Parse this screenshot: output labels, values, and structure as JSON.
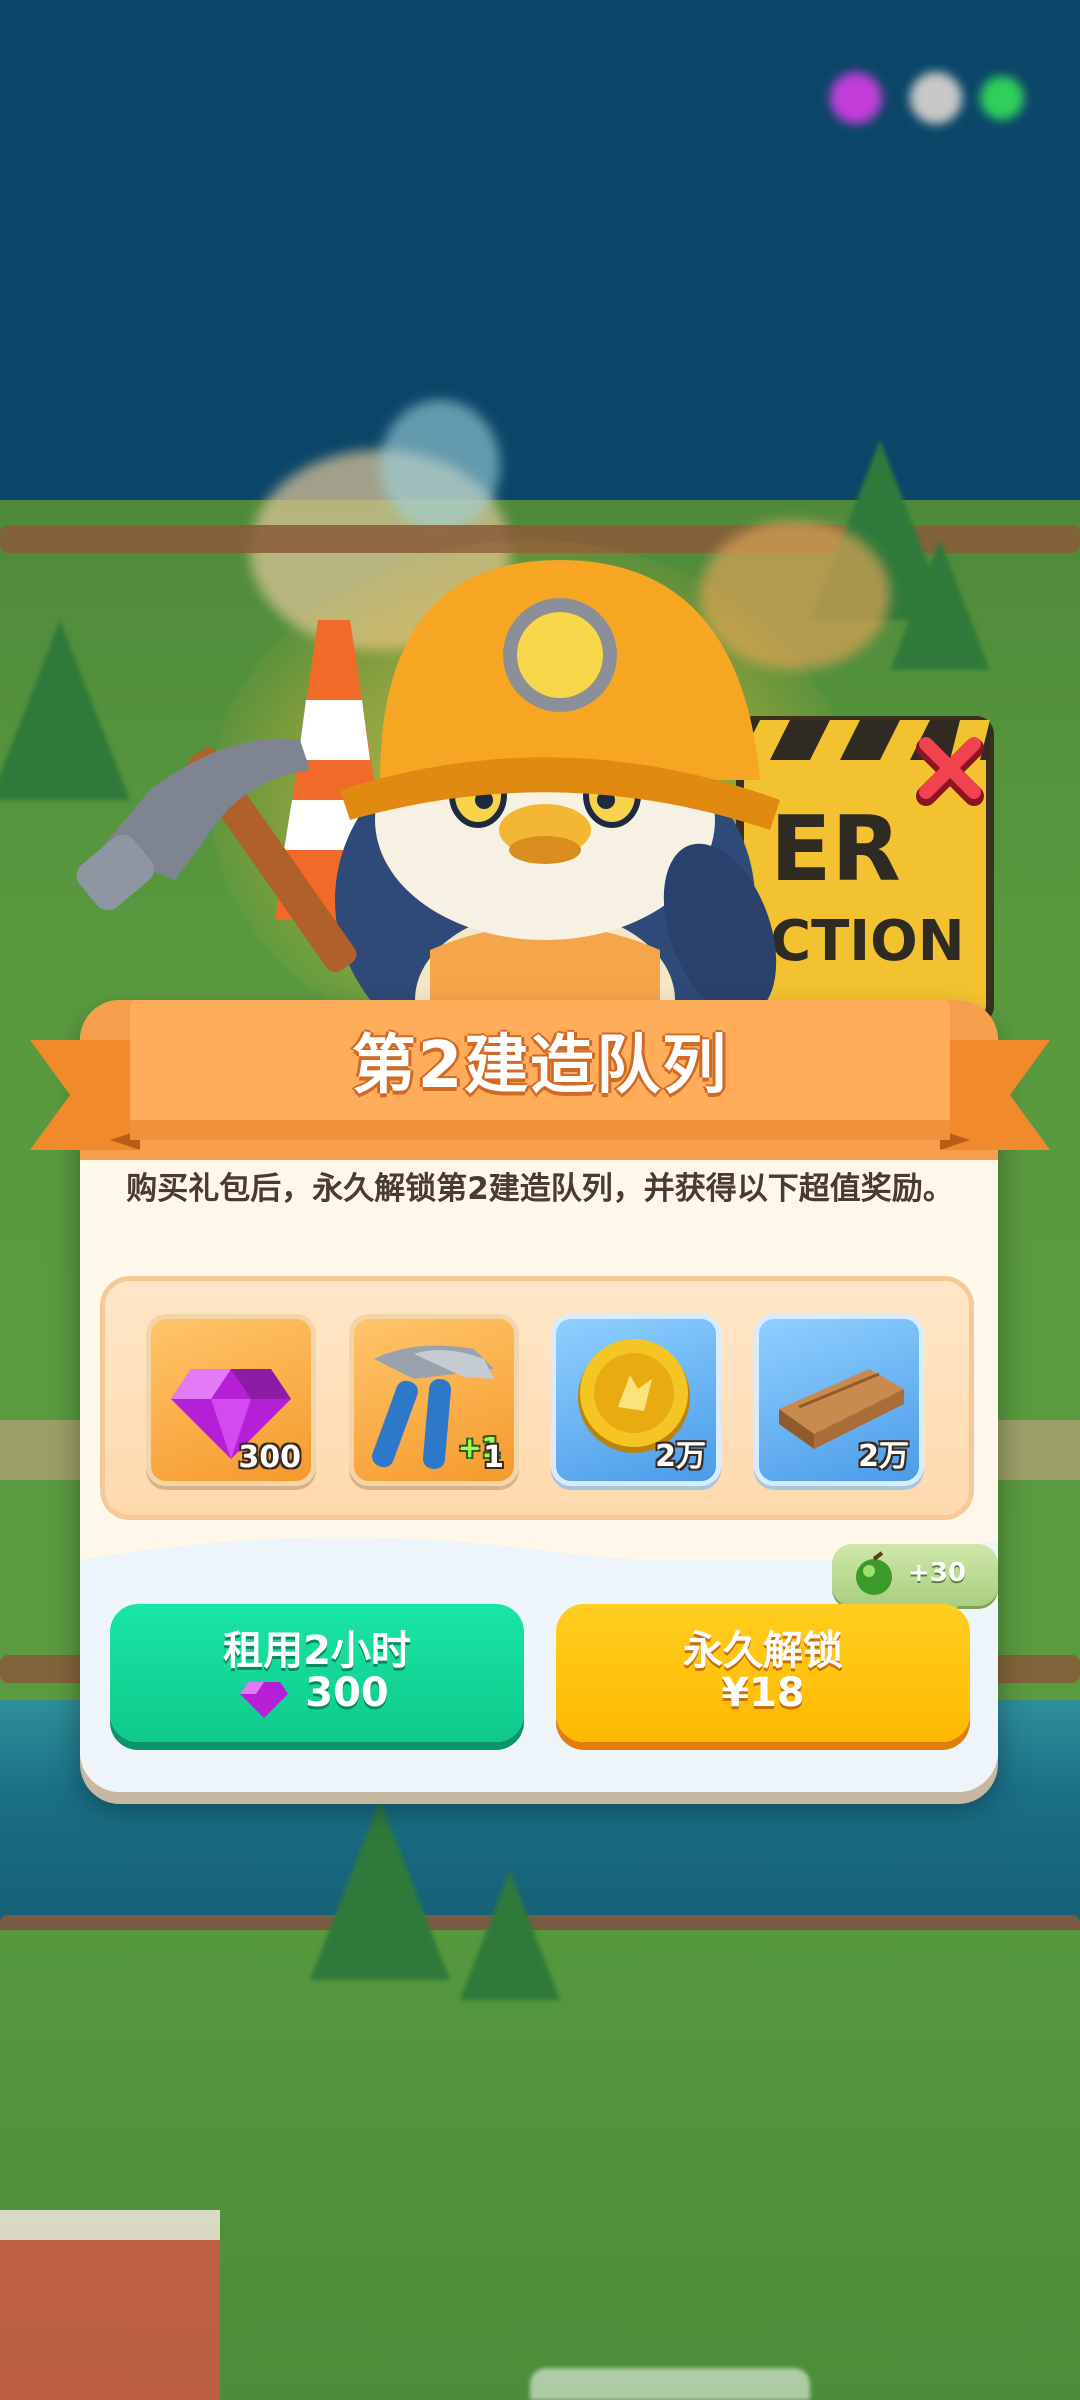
{
  "dialog": {
    "title": "第2建造队列",
    "description": "购买礼包后，永久解锁第2建造队列，并获得以下超值奖励。",
    "close_icon": "close-x-icon",
    "banner_sign": "ER\nCTION"
  },
  "rewards": [
    {
      "icon": "gem-icon",
      "count": "300"
    },
    {
      "icon": "hammer-icon",
      "count": "1",
      "bonus": "+1"
    },
    {
      "icon": "gold-coin-icon",
      "count": "2万"
    },
    {
      "icon": "wood-plank-icon",
      "count": "2万"
    }
  ],
  "bonus_tag": {
    "icon": "green-orb-icon",
    "text": "+30"
  },
  "buttons": {
    "rent": {
      "label": "租用2小时",
      "cost": "300",
      "cost_icon": "gem-icon"
    },
    "unlock": {
      "label": "永久解锁",
      "price": "¥18"
    }
  },
  "colors": {
    "rent_button": "#0fc98b",
    "unlock_button": "#ffb800",
    "ribbon": "#f79e4d",
    "title_text": "#ffffff"
  }
}
